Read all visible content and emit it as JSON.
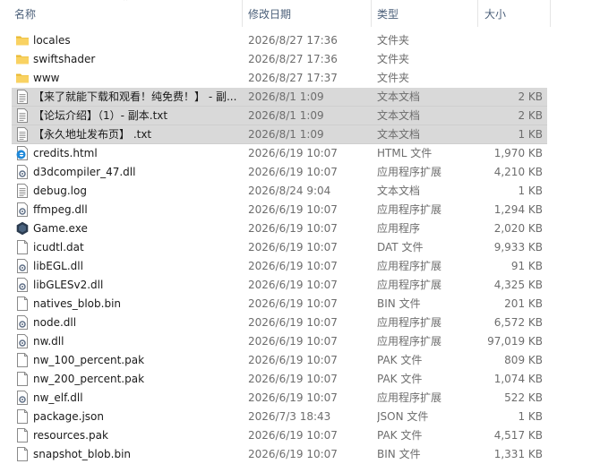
{
  "columns": {
    "name": "名称",
    "date": "修改日期",
    "type": "类型",
    "size": "大小"
  },
  "files": [
    {
      "name": "locales",
      "date": "2026/8/27 17:36",
      "type": "文件夹",
      "size": "",
      "icon": "folder-icon",
      "selected": false
    },
    {
      "name": "swiftshader",
      "date": "2026/8/27 17:36",
      "type": "文件夹",
      "size": "",
      "icon": "folder-icon",
      "selected": false
    },
    {
      "name": "www",
      "date": "2026/8/27 17:37",
      "type": "文件夹",
      "size": "",
      "icon": "folder-icon",
      "selected": false
    },
    {
      "name": "【来了就能下载和观看！纯免费！】 - 副...",
      "date": "2026/8/1 1:09",
      "type": "文本文档",
      "size": "2 KB",
      "icon": "text-file-icon",
      "selected": true
    },
    {
      "name": "【论坛介绍】（1）- 副本.txt",
      "date": "2026/8/1 1:09",
      "type": "文本文档",
      "size": "2 KB",
      "icon": "text-file-icon",
      "selected": true
    },
    {
      "name": "【永久地址发布页】 .txt",
      "date": "2026/8/1 1:09",
      "type": "文本文档",
      "size": "1 KB",
      "icon": "text-file-icon",
      "selected": true
    },
    {
      "name": "credits.html",
      "date": "2026/6/19 10:07",
      "type": "HTML 文件",
      "size": "1,970 KB",
      "icon": "edge-html-icon",
      "selected": false
    },
    {
      "name": "d3dcompiler_47.dll",
      "date": "2026/6/19 10:07",
      "type": "应用程序扩展",
      "size": "4,210 KB",
      "icon": "dll-gear-icon",
      "selected": false
    },
    {
      "name": "debug.log",
      "date": "2026/8/24 9:04",
      "type": "文本文档",
      "size": "1 KB",
      "icon": "text-file-icon",
      "selected": false
    },
    {
      "name": "ffmpeg.dll",
      "date": "2026/6/19 10:07",
      "type": "应用程序扩展",
      "size": "1,294 KB",
      "icon": "dll-gear-icon",
      "selected": false
    },
    {
      "name": "Game.exe",
      "date": "2026/6/19 10:07",
      "type": "应用程序",
      "size": "2,020 KB",
      "icon": "nwjs-app-icon",
      "selected": false
    },
    {
      "name": "icudtl.dat",
      "date": "2026/6/19 10:07",
      "type": "DAT 文件",
      "size": "9,933 KB",
      "icon": "blank-file-icon",
      "selected": false
    },
    {
      "name": "libEGL.dll",
      "date": "2026/6/19 10:07",
      "type": "应用程序扩展",
      "size": "91 KB",
      "icon": "dll-gear-icon",
      "selected": false
    },
    {
      "name": "libGLESv2.dll",
      "date": "2026/6/19 10:07",
      "type": "应用程序扩展",
      "size": "4,325 KB",
      "icon": "dll-gear-icon",
      "selected": false
    },
    {
      "name": "natives_blob.bin",
      "date": "2026/6/19 10:07",
      "type": "BIN 文件",
      "size": "201 KB",
      "icon": "blank-file-icon",
      "selected": false
    },
    {
      "name": "node.dll",
      "date": "2026/6/19 10:07",
      "type": "应用程序扩展",
      "size": "6,572 KB",
      "icon": "dll-gear-icon",
      "selected": false
    },
    {
      "name": "nw.dll",
      "date": "2026/6/19 10:07",
      "type": "应用程序扩展",
      "size": "97,019 KB",
      "icon": "dll-gear-icon",
      "selected": false
    },
    {
      "name": "nw_100_percent.pak",
      "date": "2026/6/19 10:07",
      "type": "PAK 文件",
      "size": "809 KB",
      "icon": "blank-file-icon",
      "selected": false
    },
    {
      "name": "nw_200_percent.pak",
      "date": "2026/6/19 10:07",
      "type": "PAK 文件",
      "size": "1,074 KB",
      "icon": "blank-file-icon",
      "selected": false
    },
    {
      "name": "nw_elf.dll",
      "date": "2026/6/19 10:07",
      "type": "应用程序扩展",
      "size": "522 KB",
      "icon": "dll-gear-icon",
      "selected": false
    },
    {
      "name": "package.json",
      "date": "2026/7/3 18:43",
      "type": "JSON 文件",
      "size": "1 KB",
      "icon": "blank-file-icon",
      "selected": false
    },
    {
      "name": "resources.pak",
      "date": "2026/6/19 10:07",
      "type": "PAK 文件",
      "size": "4,517 KB",
      "icon": "blank-file-icon",
      "selected": false
    },
    {
      "name": "snapshot_blob.bin",
      "date": "2026/6/19 10:07",
      "type": "BIN 文件",
      "size": "1,331 KB",
      "icon": "blank-file-icon",
      "selected": false
    }
  ]
}
